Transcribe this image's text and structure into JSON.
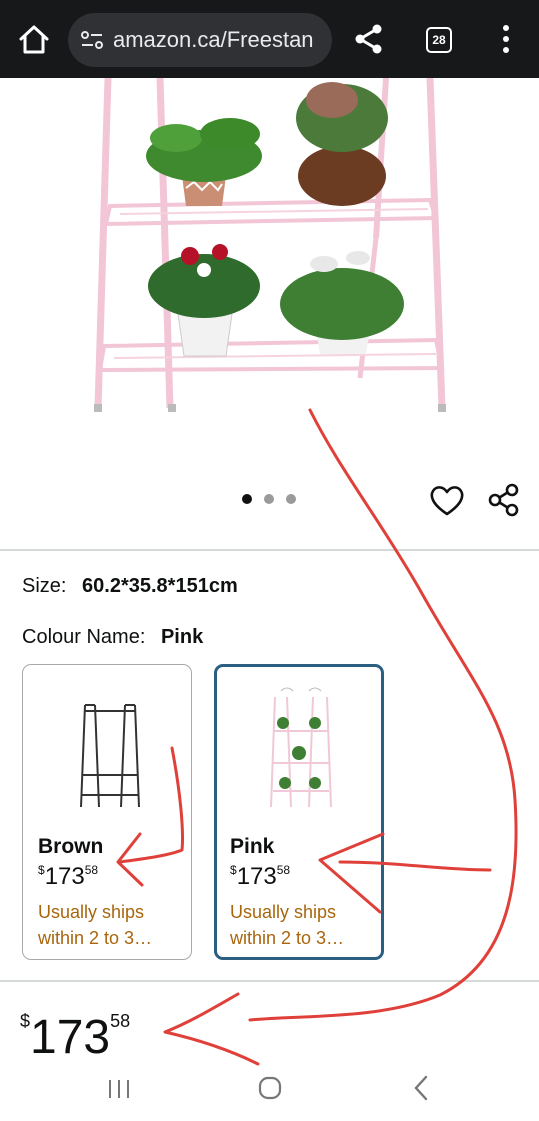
{
  "browser": {
    "url": "amazon.ca/Freestan",
    "tab_count": "28",
    "colors": {
      "toolbar": "#17181a",
      "urlbox": "#2f3134"
    }
  },
  "gallery": {
    "page_count": 3,
    "active_page": 1
  },
  "product": {
    "size_label": "Size:",
    "size_value": "60.2*35.8*151cm",
    "colour_label": "Colour Name:",
    "colour_value": "Pink",
    "variants": [
      {
        "name": "Brown",
        "currency": "$",
        "price_whole": "173",
        "price_fraction": "58",
        "shipping": "Usually ships within 2 to 3…",
        "selected": false
      },
      {
        "name": "Pink",
        "currency": "$",
        "price_whole": "173",
        "price_fraction": "58",
        "shipping": "Usually ships within 2 to 3…",
        "selected": true
      }
    ],
    "price": {
      "currency": "$",
      "whole": "173",
      "fraction": "58"
    }
  },
  "colors": {
    "selected_border": "#2b5f82",
    "shipping_text": "#a8660d",
    "annotation_red": "#e0403a"
  },
  "icons": [
    "home-icon",
    "site-settings-icon",
    "share-icon",
    "tab-switcher-icon",
    "more-vert-icon",
    "heart-icon",
    "share-icon",
    "recent-apps-icon",
    "home-circle-icon",
    "back-icon"
  ]
}
